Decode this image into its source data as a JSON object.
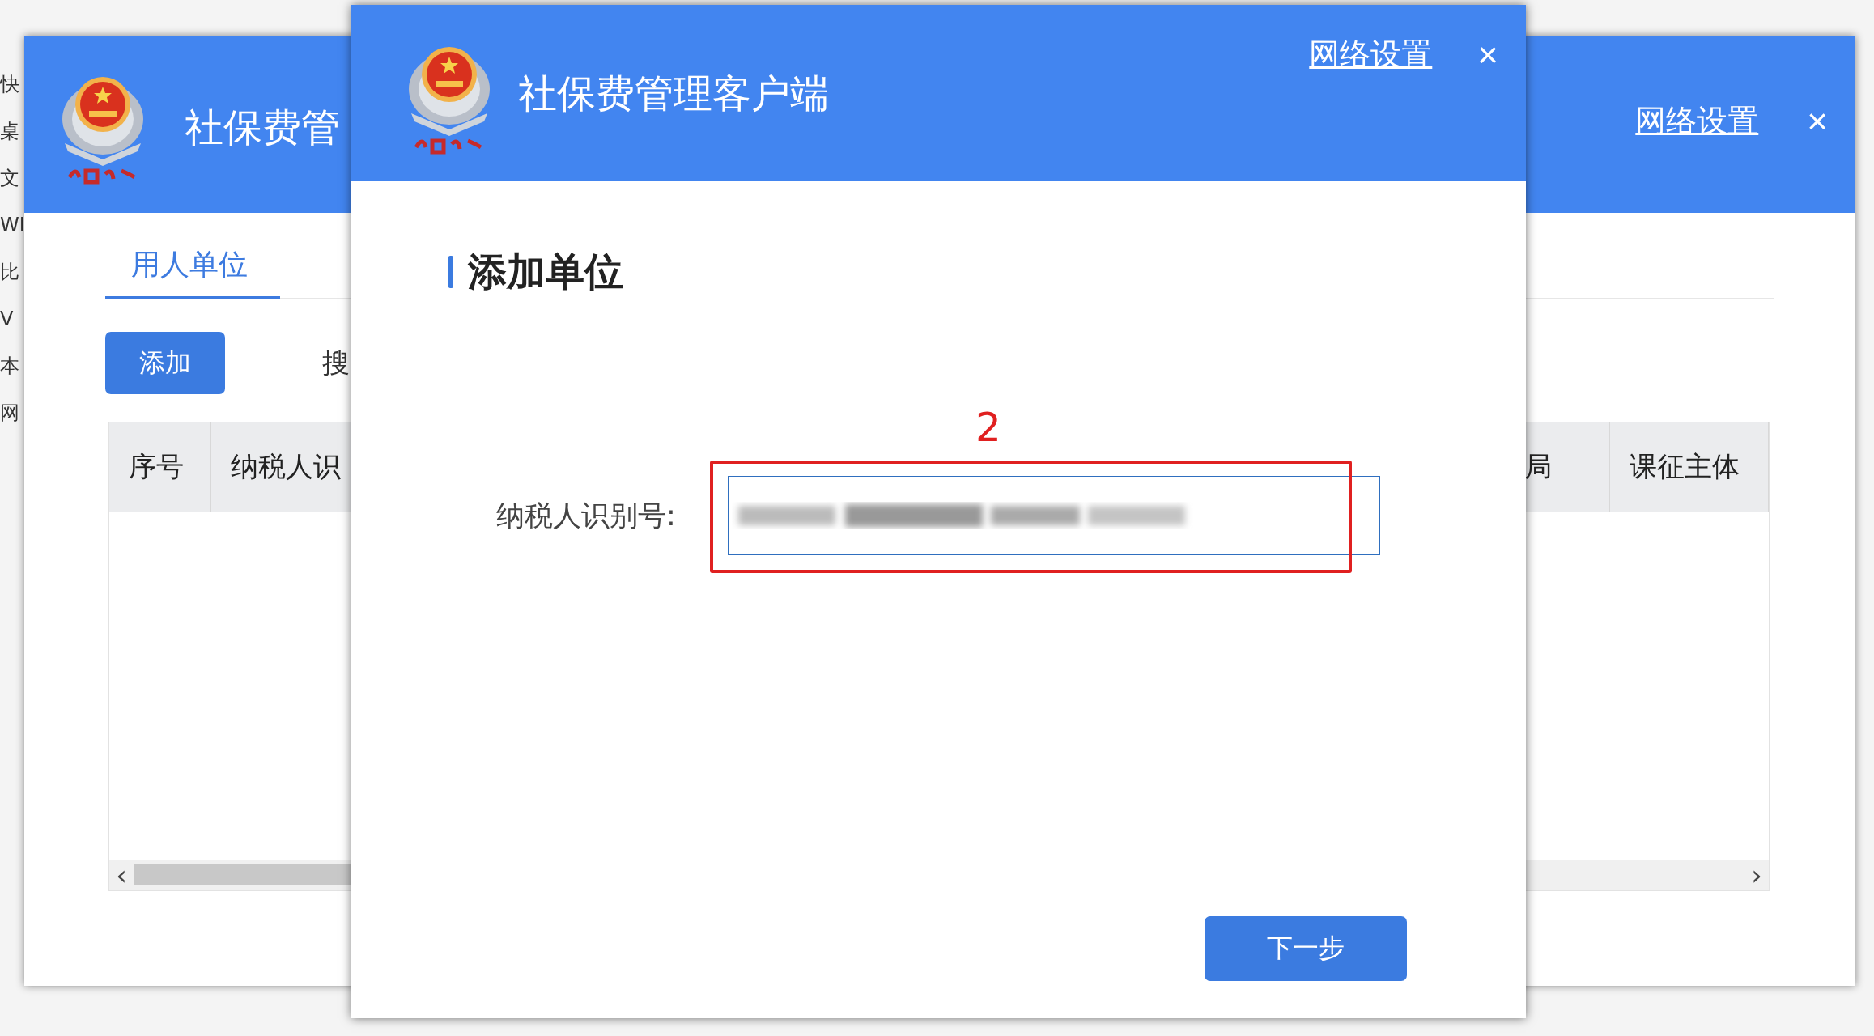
{
  "desktop": {
    "fragments": [
      "快",
      "桌",
      "文",
      "WI",
      "比",
      "V",
      "本",
      "网"
    ]
  },
  "main_window": {
    "title": "社保费管",
    "network_link": "网络设置",
    "close": "×",
    "tabs": [
      {
        "label": "用人单位",
        "selected": true
      }
    ],
    "add_button": "添加",
    "search_label": "搜",
    "table": {
      "columns": [
        {
          "label": "序号"
        },
        {
          "label": "纳税人识"
        },
        {
          "label": "局"
        },
        {
          "label": "课征主体"
        }
      ]
    },
    "scrollbar": {
      "left": "‹",
      "right": "›"
    }
  },
  "dialog": {
    "title": "社保费管理客户端",
    "network_link": "网络设置",
    "close": "×",
    "heading": "添加单位",
    "field": {
      "label": "纳税人识别号:",
      "redacted": true
    },
    "annotation": {
      "label": "2"
    },
    "next_button": "下一步"
  }
}
